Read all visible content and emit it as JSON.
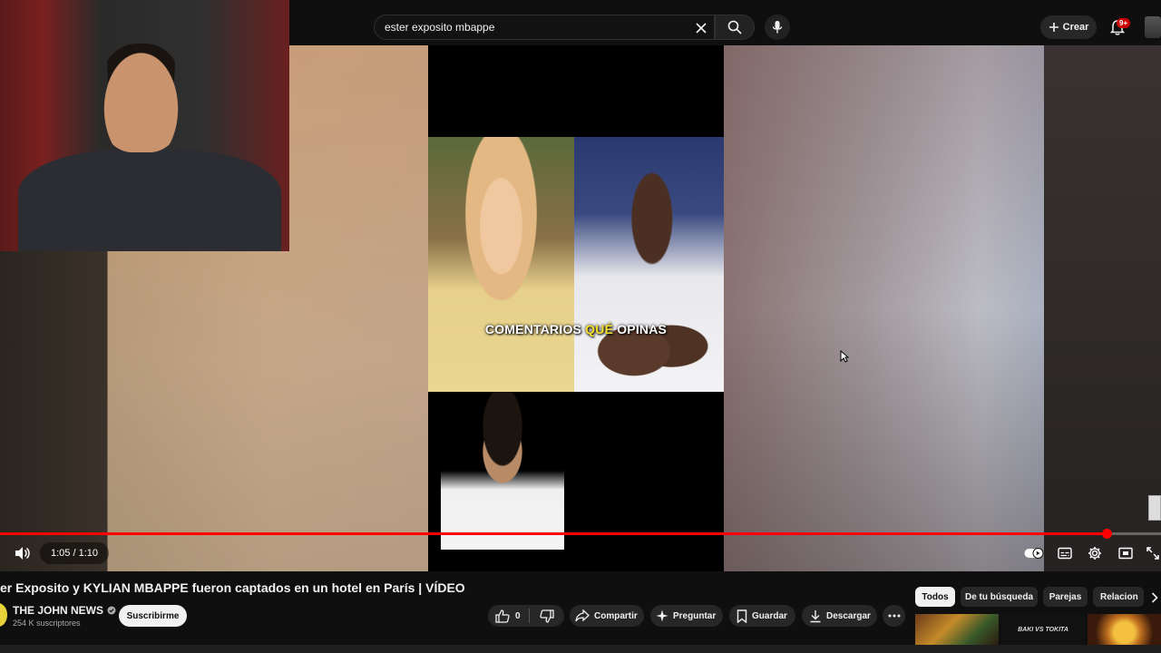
{
  "search": {
    "query": "ester exposito mbappe"
  },
  "header": {
    "create_label": "Crear",
    "notification_badge": "9+"
  },
  "video": {
    "caption_white": "COMENTARIOS ",
    "caption_highlight": "QUÉ",
    "caption_rest": " OPINAS",
    "highlight_color": "#f7e12b",
    "progress_fraction": 0.953
  },
  "player": {
    "time_current": "1:05",
    "time_total": "1:10",
    "time_display": "1:05 / 1:10",
    "progress_color": "#ff0000"
  },
  "title": "er Exposito y KYLIAN MBAPPE fueron captados en un hotel en París | VÍDEO",
  "channel": {
    "name": "THE JOHN NEWS",
    "subscribers": "254 K suscriptores",
    "subscribe_label": "Suscribirme"
  },
  "actions": {
    "like_count": "0",
    "share_label": "Compartir",
    "ask_label": "Preguntar",
    "save_label": "Guardar",
    "download_label": "Descargar"
  },
  "chips": [
    {
      "label": "Todos",
      "active": true
    },
    {
      "label": "De tu búsqueda",
      "active": false
    },
    {
      "label": "Parejas",
      "active": false
    },
    {
      "label": "Relacion",
      "active": false
    }
  ],
  "recommendation": {
    "thumb_text": "BAKI VS TOKITA"
  }
}
